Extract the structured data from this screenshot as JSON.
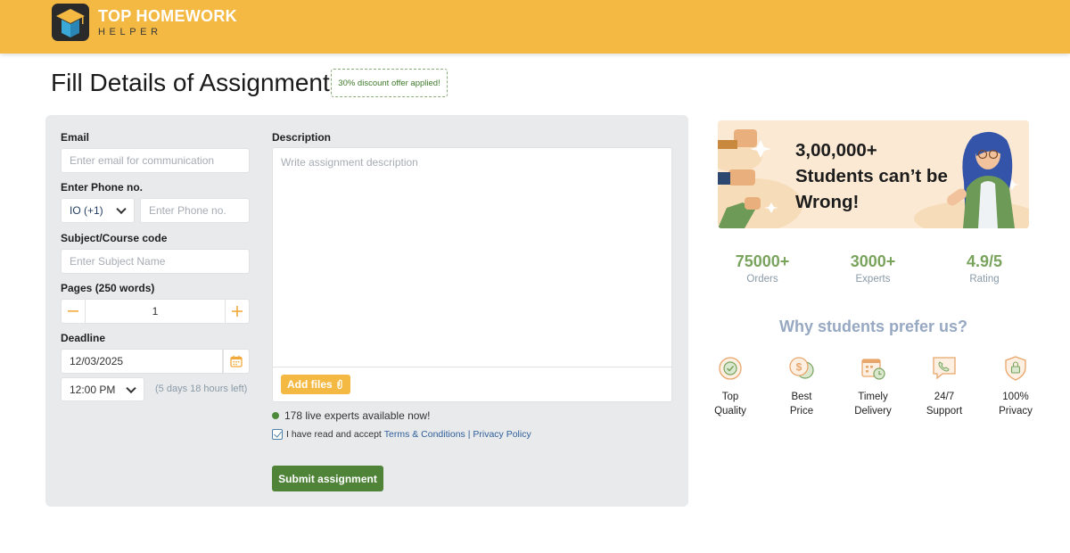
{
  "brand": {
    "name_line1": "TOP HOMEWORK",
    "name_line2": "HELPER"
  },
  "page": {
    "title": "Fill Details of Assignment",
    "discount_badge": "30% discount offer applied!"
  },
  "form": {
    "email_label": "Email",
    "email_placeholder": "Enter email for communication",
    "phone_label": "Enter Phone no.",
    "country_code": "IO (+1)",
    "phone_placeholder": "Enter Phone no.",
    "subject_label": "Subject/Course code",
    "subject_placeholder": "Enter Subject Name",
    "pages_label": "Pages (250 words)",
    "pages_minus": "—",
    "pages_value": "1",
    "pages_plus": "+",
    "deadline_label": "Deadline",
    "deadline_date": "12/03/2025",
    "deadline_time": "12:00 PM",
    "time_left": "(5 days 18 hours left)",
    "description_label": "Description",
    "description_placeholder": "Write assignment description",
    "add_files_label": "Add files",
    "live_experts": "178 live experts available now!",
    "terms_prefix": "I have read and accept",
    "terms_link": "Terms & Conditions",
    "terms_separator": "|",
    "privacy_link": "Privacy Policy",
    "terms_checked": true,
    "submit_label": "Submit assignment"
  },
  "banner": {
    "line1": "3,00,000+",
    "line2": "Students can’t be",
    "line3": "Wrong!"
  },
  "stats": [
    {
      "value": "75000+",
      "label": "Orders"
    },
    {
      "value": "3000+",
      "label": "Experts"
    },
    {
      "value": "4.9/5",
      "label": "Rating"
    }
  ],
  "why": {
    "heading": "Why students prefer us?",
    "features": [
      {
        "line1": "Top",
        "line2": "Quality",
        "icon": "quality-badge-icon"
      },
      {
        "line1": "Best",
        "line2": "Price",
        "icon": "coins-icon"
      },
      {
        "line1": "Timely",
        "line2": "Delivery",
        "icon": "calendar-clock-icon"
      },
      {
        "line1": "24/7",
        "line2": "Support",
        "icon": "phone-chat-icon"
      },
      {
        "line1": "100%",
        "line2": "Privacy",
        "icon": "shield-lock-icon"
      }
    ]
  },
  "colors": {
    "brand_yellow": "#f4b942",
    "accent_green": "#4f8438",
    "stat_green": "#7aa35e",
    "heading_blue": "#97a8c2",
    "icon_orange": "#e8a66b"
  }
}
